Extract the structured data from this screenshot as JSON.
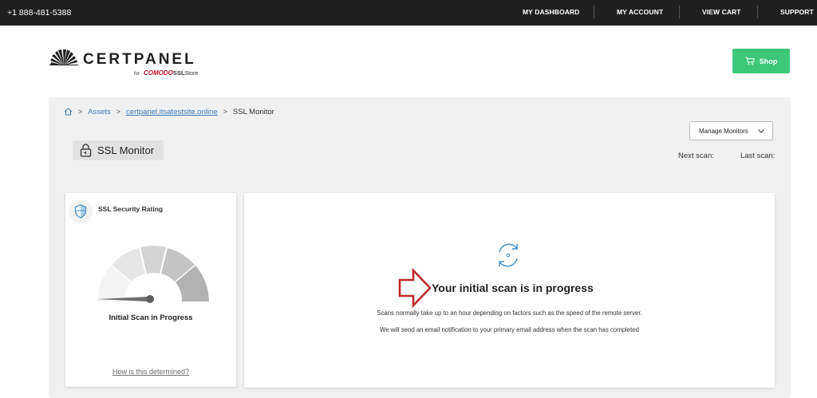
{
  "topbar": {
    "phone": "+1 888-481-5388",
    "nav": [
      "MY DASHBOARD",
      "MY ACCOUNT",
      "VIEW CART",
      "SUPPORT"
    ]
  },
  "logo": {
    "wordmark": "CERTPANEL",
    "for": "for",
    "comodo": "COMODO",
    "ssl": "SSL",
    "store": "Store"
  },
  "shop": {
    "label": "Shop",
    "color": "#3cc878"
  },
  "breadcrumb": {
    "items": [
      "Assets",
      "certpanel.itsatestsite.online",
      "SSL Monitor"
    ]
  },
  "manage": {
    "label": "Manage Monitors"
  },
  "page": {
    "title": "SSL Monitor"
  },
  "scan": {
    "next_label": "Next scan:",
    "last_label": "Last scan:"
  },
  "rating_card": {
    "title": "SSL Security Rating",
    "status": "Initial Scan in Progress",
    "link": "How is this determined?"
  },
  "progress_card": {
    "heading": "Your initial scan is in progress",
    "line1": "Scans normally take up to an hour depending on factors such as the speed of the remote server.",
    "line2": "We will send an email notification to your primary email address when the scan has completed"
  },
  "colors": {
    "topbar": "#1f1f1f",
    "link": "#3a7ab8",
    "accent_icon": "#4a90c8",
    "arrow": "#c0282d"
  }
}
